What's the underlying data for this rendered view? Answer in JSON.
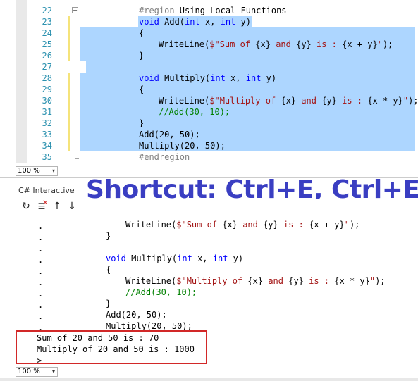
{
  "editor": {
    "line_numbers": [
      "22",
      "23",
      "24",
      "25",
      "26",
      "27",
      "28",
      "29",
      "30",
      "31",
      "32",
      "33",
      "34",
      "35"
    ],
    "lines": {
      "l22": [
        "#region",
        " Using Local Functions"
      ],
      "l23": [
        "void",
        " Add(",
        "int",
        " x, ",
        "int",
        " y)"
      ],
      "l24": "{",
      "l25": [
        "WriteLine(",
        "$\"Sum of ",
        "{x}",
        " and ",
        "{y}",
        " is : ",
        "{x + y}",
        "\"",
        ");"
      ],
      "l26": "}",
      "l28": [
        "void",
        " Multiply(",
        "int",
        " x, ",
        "int",
        " y)"
      ],
      "l29": "{",
      "l30": [
        "WriteLine(",
        "$\"Multiply of ",
        "{x}",
        " and ",
        "{y}",
        " is : ",
        "{x * y}",
        "\"",
        ");"
      ],
      "l31": "//Add(30, 10);",
      "l32": "}",
      "l33": "Add(20, 50);",
      "l34": "Multiply(20, 50);",
      "l35": "#endregion"
    },
    "collapse_glyph": "−"
  },
  "zoom_top": {
    "value": "100 %",
    "arrow": "▾"
  },
  "interactive": {
    "title": "C# Interactive",
    "overlay_text": "Shortcut: Ctrl+E, Ctrl+E",
    "toolbar": {
      "reset_glyph": "↻",
      "clear_glyph": "☰",
      "up_glyph": "↑",
      "down_glyph": "↓"
    },
    "dots": ".",
    "lines": {
      "t1": [
        "WriteLine(",
        "$\"Sum of ",
        "{x}",
        " and ",
        "{y}",
        " is : ",
        "{x + y}",
        "\"",
        ");"
      ],
      "t2": "}",
      "t4": [
        "void",
        " Multiply(",
        "int",
        " x, ",
        "int",
        " y)"
      ],
      "t5": "{",
      "t6": [
        "WriteLine(",
        "$\"Multiply of ",
        "{x}",
        " and ",
        "{y}",
        " is : ",
        "{x * y}",
        "\"",
        ");"
      ],
      "t7": "//Add(30, 10);",
      "t8": "}",
      "t9": "Add(20, 50);",
      "t10": "Multiply(20, 50);"
    },
    "output": [
      "Sum of 20 and 50 is : 70",
      "Multiply of 20 and 50 is : 1000"
    ],
    "prompt": ">"
  },
  "zoom_bottom": {
    "value": "100 %",
    "arrow": "▾"
  }
}
